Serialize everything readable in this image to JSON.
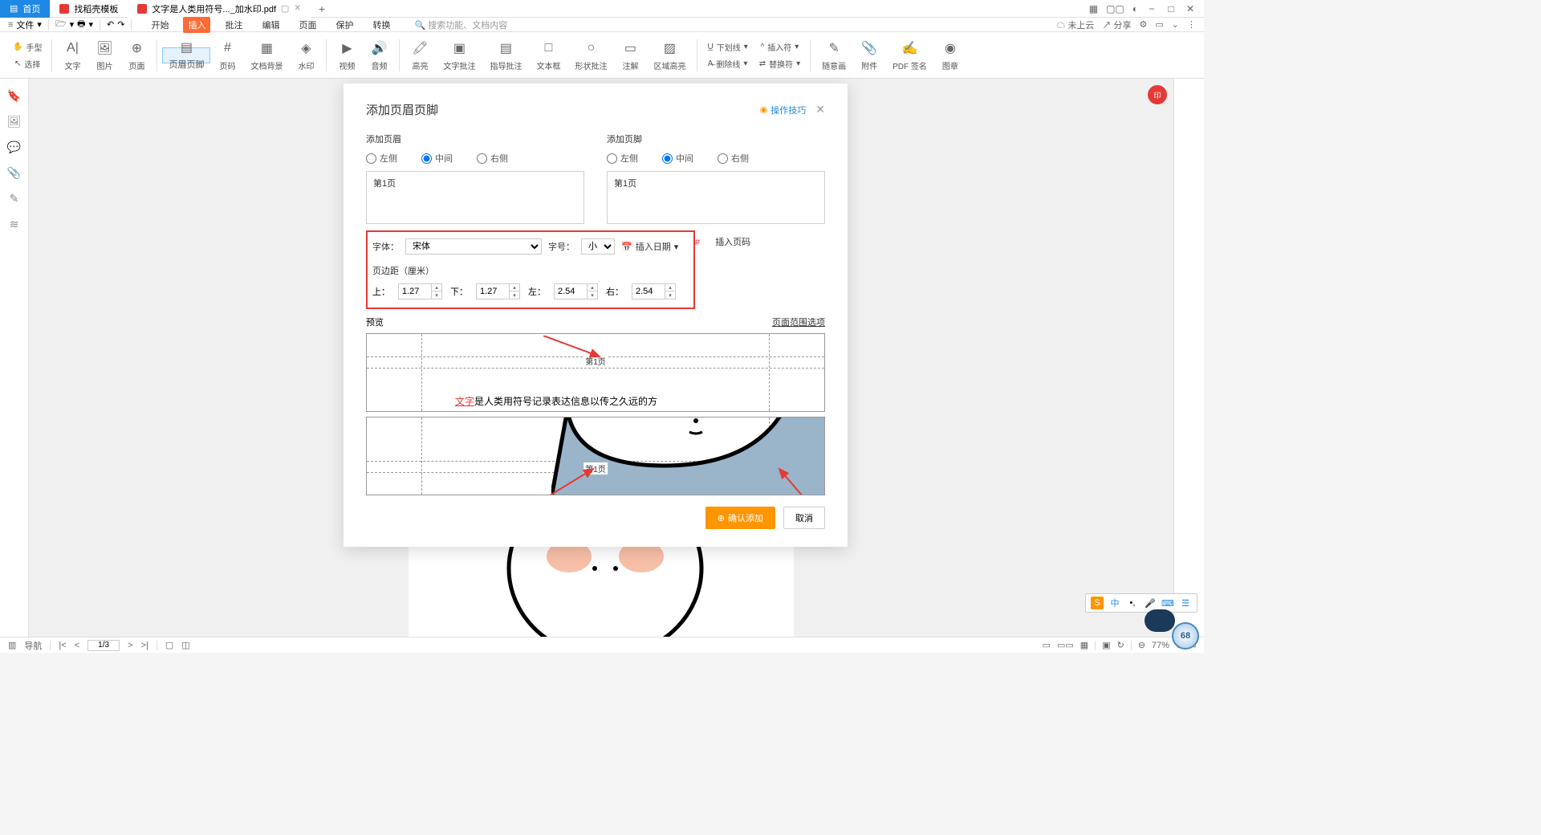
{
  "tabs": {
    "home": "首页",
    "t1": "找稻壳模板",
    "t2": "文字是人类用符号..._加水印.pdf"
  },
  "winControls": [
    "−",
    "□",
    "✕"
  ],
  "topright": {
    "grid": "▦",
    "apps": "▢▢",
    "avatar": "◐"
  },
  "file_menu": "文件",
  "menu": {
    "start": "开始",
    "insert": "插入",
    "annotate": "批注",
    "edit": "编辑",
    "page": "页面",
    "protect": "保护",
    "convert": "转换"
  },
  "search_placeholder": "搜索功能、文档内容",
  "cloud": "未上云",
  "share": "分享",
  "hand": "手型",
  "select": "选择",
  "tools": {
    "text": "文字",
    "image": "图片",
    "pagebtn": "页面",
    "headerfooter": "页眉页脚",
    "pagenum": "页码",
    "docbg": "文档背景",
    "watermark": "水印",
    "video": "视频",
    "audio": "音频",
    "highlight": "高亮",
    "textannot": "文字批注",
    "guideannot": "指导批注",
    "textbox": "文本框",
    "shapeannot": "形状批注",
    "note": "注解",
    "areahl": "区域高亮",
    "underline": "下划线",
    "strike": "删除线",
    "insertsym": "插入符",
    "replacesym": "替换符",
    "handwrite": "随意画",
    "attach": "附件",
    "pdfsign": "PDF 签名",
    "stamp": "图章"
  },
  "dialog": {
    "title": "添加页眉页脚",
    "tips": "操作技巧",
    "header_label": "添加页眉",
    "footer_label": "添加页脚",
    "pos": {
      "left": "左侧",
      "center": "中间",
      "right": "右侧"
    },
    "content": "第1页",
    "font_label": "字体：",
    "font_value": "宋体",
    "size_label": "字号：",
    "size_value": "小四",
    "insert_date": "插入日期",
    "insert_pagenum": "插入页码",
    "margin_label": "页边距（厘米）",
    "margins": {
      "top_l": "上：",
      "top": "1.27",
      "bottom_l": "下：",
      "bottom": "1.27",
      "left_l": "左：",
      "left": "2.54",
      "right_l": "右：",
      "right": "2.54"
    },
    "preview": "预览",
    "range": "页面范围选项",
    "preview_page": "第1页",
    "preview_body": "是人类用符号记录表达信息以传之久远的方",
    "preview_red": "文字",
    "confirm": "确认添加",
    "cancel": "取消"
  },
  "status": {
    "nav": "导航",
    "page": "1/3",
    "zoom": "77%"
  },
  "ime": {
    "logo": "S",
    "lang": "中",
    "punct": "•,",
    "mic": "🎤",
    "kbd": "⌨",
    "set": "☰"
  },
  "circle": "68"
}
